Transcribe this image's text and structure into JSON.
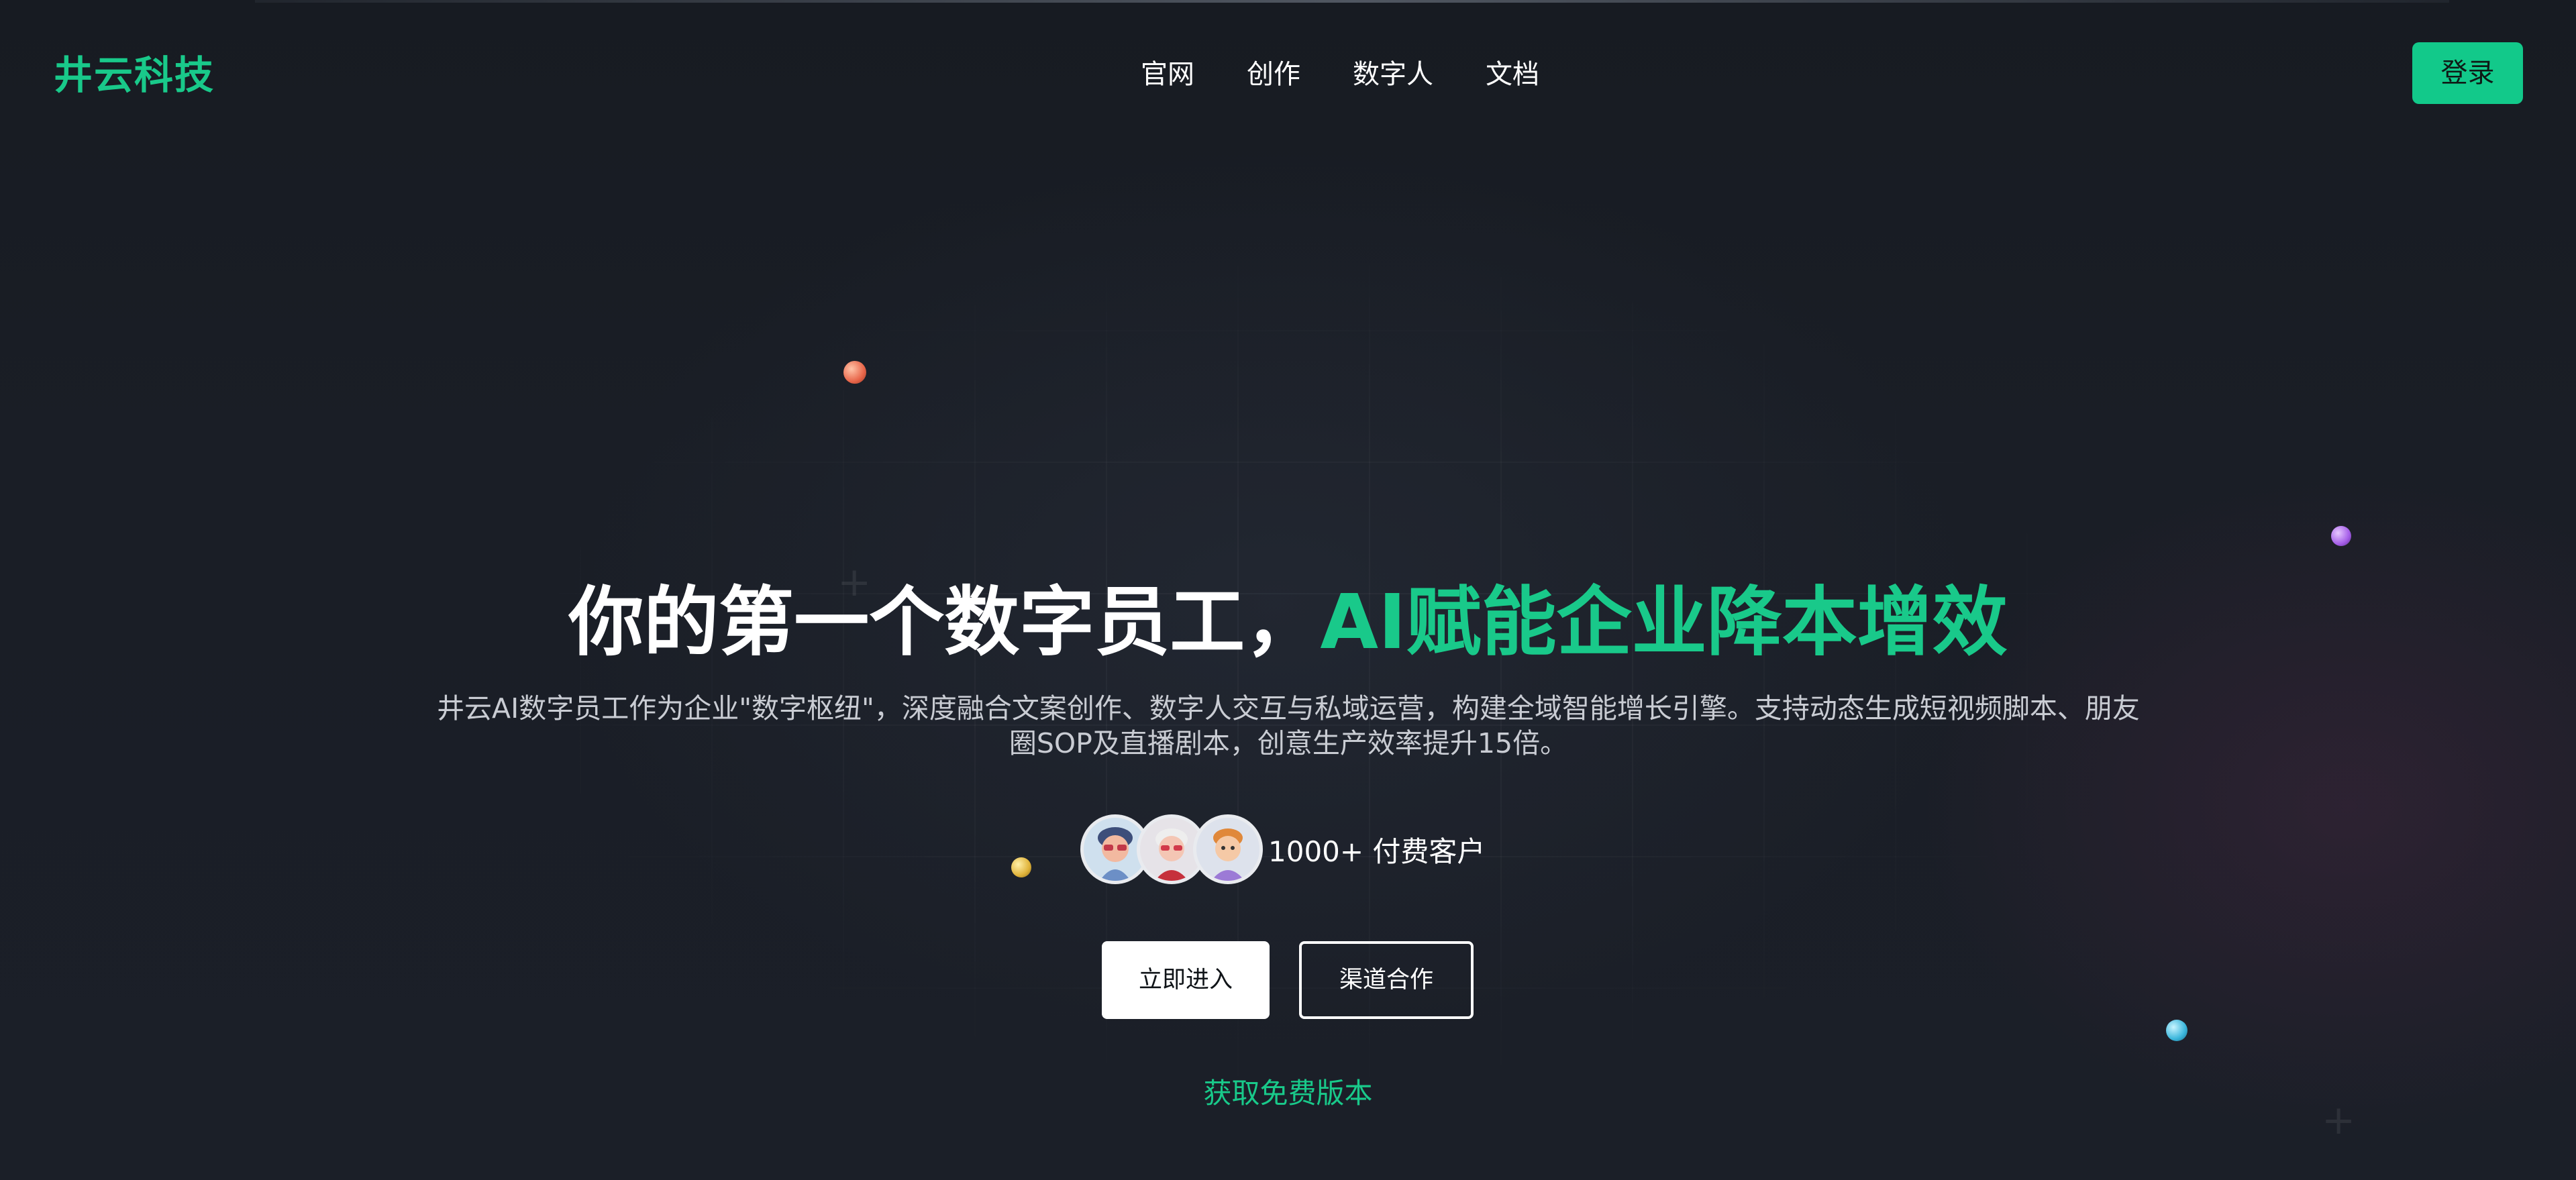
{
  "header": {
    "logo": "井云科技",
    "nav": [
      "官网",
      "创作",
      "数字人",
      "文档"
    ],
    "login_label": "登录"
  },
  "hero": {
    "title_white": "你的第一个数字员工，",
    "title_green": "AI赋能企业降本增效",
    "description": "井云AI数字员工作为企业\"数字枢纽\"，深度融合文案创作、数字人交互与私域运营，构建全域智能增长引擎。支持动态生成短视频脚本、朋友圈SOP及直播剧本，创意生产效率提升15倍。",
    "customers_label": "1000+ 付费客户",
    "primary_button": "立即进入",
    "secondary_button": "渠道合作",
    "free_link": "获取免费版本"
  },
  "colors": {
    "accent": "#19c98a",
    "background": "#161b24"
  },
  "icons": [
    "customer-avatar-1",
    "customer-avatar-2",
    "customer-avatar-3"
  ]
}
